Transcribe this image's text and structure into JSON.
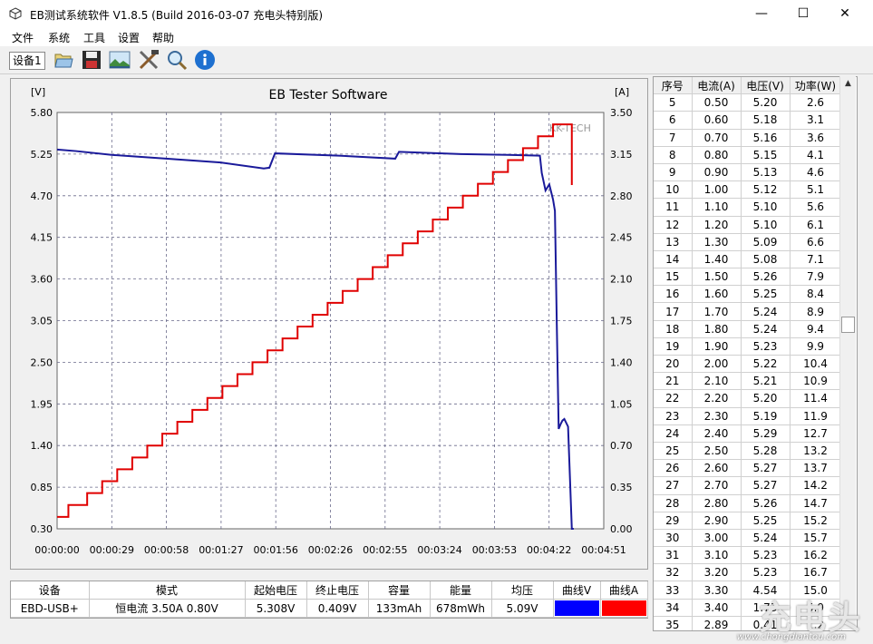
{
  "window": {
    "title": "EB测试系统软件 V1.8.5 (Build 2016-03-07 充电头特别版)",
    "minimize": "—",
    "maximize": "☐",
    "close": "✕"
  },
  "menu": [
    "文件",
    "系统",
    "工具",
    "设置",
    "帮助"
  ],
  "toolbar": {
    "device_tab": "设备1",
    "icons": [
      "folder-icon",
      "save-icon",
      "image-icon",
      "tools-icon",
      "search-icon",
      "info-icon"
    ]
  },
  "chart_data": {
    "type": "line",
    "title": "EB Tester Software",
    "left_unit": "[V]",
    "right_unit": "[A]",
    "y_left_ticks": [
      "5.80",
      "5.25",
      "4.70",
      "4.15",
      "3.60",
      "3.05",
      "2.50",
      "1.95",
      "1.40",
      "0.85",
      "0.30"
    ],
    "y_right_ticks": [
      "3.50",
      "3.15",
      "2.80",
      "2.45",
      "2.10",
      "1.75",
      "1.40",
      "1.05",
      "0.70",
      "0.35",
      "0.00"
    ],
    "ylim_left": [
      0.3,
      5.8
    ],
    "ylim_right": [
      0.0,
      3.5
    ],
    "x_ticks": [
      "00:00:00",
      "00:00:29",
      "00:00:58",
      "00:01:27",
      "00:01:56",
      "00:02:26",
      "00:02:55",
      "00:03:24",
      "00:03:53",
      "00:04:22",
      "00:04:51"
    ],
    "xlim_seconds": [
      0,
      291
    ],
    "grid": true,
    "watermark": "KK-TECH",
    "series": [
      {
        "axis": "left",
        "color": "#1a1a9a",
        "x": [
          0,
          10,
          29,
          58,
          87,
          110,
          113,
          116,
          150,
          180,
          182,
          215,
          240,
          257,
          258,
          260,
          262,
          264,
          265,
          266,
          267,
          268,
          269,
          270,
          272,
          274,
          275
        ],
        "y": [
          5.31,
          5.29,
          5.24,
          5.19,
          5.14,
          5.06,
          5.07,
          5.26,
          5.23,
          5.19,
          5.28,
          5.25,
          5.24,
          5.23,
          5.0,
          4.77,
          4.85,
          4.65,
          4.5,
          3.0,
          1.62,
          1.68,
          1.73,
          1.75,
          1.65,
          0.3,
          0.3
        ]
      },
      {
        "axis": "right",
        "color": "#e00000",
        "x": [
          0,
          6,
          16,
          24,
          32,
          40,
          48,
          56,
          64,
          72,
          80,
          88,
          96,
          104,
          112,
          120,
          128,
          136,
          144,
          152,
          160,
          168,
          176,
          184,
          192,
          200,
          208,
          216,
          224,
          232,
          240,
          248,
          256,
          264,
          270,
          274
        ],
        "y": [
          0.1,
          0.2,
          0.3,
          0.4,
          0.5,
          0.6,
          0.7,
          0.8,
          0.9,
          1.0,
          1.1,
          1.2,
          1.3,
          1.4,
          1.5,
          1.6,
          1.7,
          1.8,
          1.9,
          2.0,
          2.1,
          2.2,
          2.3,
          2.4,
          2.5,
          2.6,
          2.7,
          2.8,
          2.9,
          3.0,
          3.1,
          3.2,
          3.3,
          3.4,
          3.4,
          2.89
        ]
      }
    ]
  },
  "readings": {
    "headers": [
      "序号",
      "电流(A)",
      "电压(V)",
      "功率(W)"
    ],
    "rows": [
      [
        "5",
        "0.50",
        "5.20",
        "2.6"
      ],
      [
        "6",
        "0.60",
        "5.18",
        "3.1"
      ],
      [
        "7",
        "0.70",
        "5.16",
        "3.6"
      ],
      [
        "8",
        "0.80",
        "5.15",
        "4.1"
      ],
      [
        "9",
        "0.90",
        "5.13",
        "4.6"
      ],
      [
        "10",
        "1.00",
        "5.12",
        "5.1"
      ],
      [
        "11",
        "1.10",
        "5.10",
        "5.6"
      ],
      [
        "12",
        "1.20",
        "5.10",
        "6.1"
      ],
      [
        "13",
        "1.30",
        "5.09",
        "6.6"
      ],
      [
        "14",
        "1.40",
        "5.08",
        "7.1"
      ],
      [
        "15",
        "1.50",
        "5.26",
        "7.9"
      ],
      [
        "16",
        "1.60",
        "5.25",
        "8.4"
      ],
      [
        "17",
        "1.70",
        "5.24",
        "8.9"
      ],
      [
        "18",
        "1.80",
        "5.24",
        "9.4"
      ],
      [
        "19",
        "1.90",
        "5.23",
        "9.9"
      ],
      [
        "20",
        "2.00",
        "5.22",
        "10.4"
      ],
      [
        "21",
        "2.10",
        "5.21",
        "10.9"
      ],
      [
        "22",
        "2.20",
        "5.20",
        "11.4"
      ],
      [
        "23",
        "2.30",
        "5.19",
        "11.9"
      ],
      [
        "24",
        "2.40",
        "5.29",
        "12.7"
      ],
      [
        "25",
        "2.50",
        "5.28",
        "13.2"
      ],
      [
        "26",
        "2.60",
        "5.27",
        "13.7"
      ],
      [
        "27",
        "2.70",
        "5.27",
        "14.2"
      ],
      [
        "28",
        "2.80",
        "5.26",
        "14.7"
      ],
      [
        "29",
        "2.90",
        "5.25",
        "15.2"
      ],
      [
        "30",
        "3.00",
        "5.24",
        "15.7"
      ],
      [
        "31",
        "3.10",
        "5.23",
        "16.2"
      ],
      [
        "32",
        "3.20",
        "5.23",
        "16.7"
      ],
      [
        "33",
        "3.30",
        "4.54",
        "15.0"
      ],
      [
        "34",
        "3.40",
        "1.73",
        "5.9"
      ],
      [
        "35",
        "2.89",
        "0.41",
        "1.2"
      ]
    ]
  },
  "summary": {
    "headers": [
      "设备",
      "模式",
      "起始电压",
      "终止电压",
      "容量",
      "能量",
      "均压",
      "曲线V",
      "曲线A"
    ],
    "values": [
      "EBD-USB+",
      "恒电流  3.50A  0.80V",
      "5.308V",
      "0.409V",
      "133mAh",
      "678mWh",
      "5.09V"
    ],
    "curve_v_color": "#0000ff",
    "curve_a_color": "#ff0000"
  },
  "watermark": {
    "text": "充电头",
    "url": "www.chongdiantou.com"
  }
}
